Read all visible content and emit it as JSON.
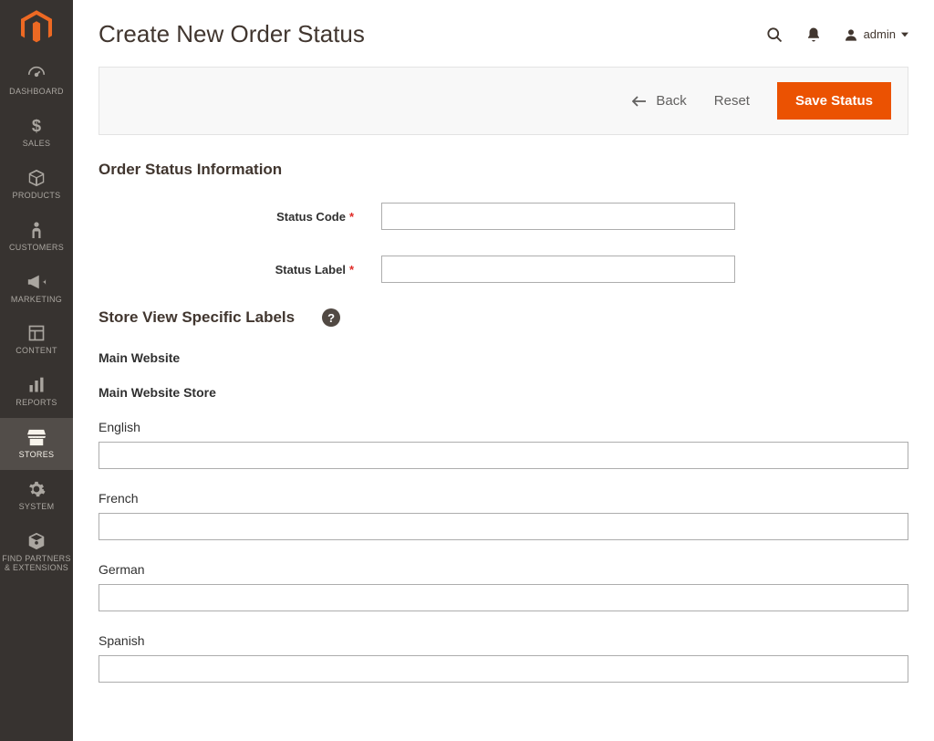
{
  "sidebar": {
    "items": [
      {
        "label": "DASHBOARD",
        "icon": "dashboard"
      },
      {
        "label": "SALES",
        "icon": "dollar"
      },
      {
        "label": "PRODUCTS",
        "icon": "box"
      },
      {
        "label": "CUSTOMERS",
        "icon": "person"
      },
      {
        "label": "MARKETING",
        "icon": "megaphone"
      },
      {
        "label": "CONTENT",
        "icon": "layout"
      },
      {
        "label": "REPORTS",
        "icon": "bars"
      },
      {
        "label": "STORES",
        "icon": "stores"
      },
      {
        "label": "SYSTEM",
        "icon": "gear"
      },
      {
        "label": "FIND PARTNERS & EXTENSIONS",
        "icon": "puzzle"
      }
    ],
    "activeIndex": 7
  },
  "header": {
    "title": "Create New Order Status",
    "user": "admin"
  },
  "toolbar": {
    "back": "Back",
    "reset": "Reset",
    "save": "Save Status"
  },
  "section1": {
    "title": "Order Status Information",
    "statusCodeLabel": "Status Code",
    "statusLabelLabel": "Status Label"
  },
  "section2": {
    "title": "Store View Specific Labels",
    "website": "Main Website",
    "store": "Main Website Store",
    "languages": [
      "English",
      "French",
      "German",
      "Spanish"
    ]
  }
}
